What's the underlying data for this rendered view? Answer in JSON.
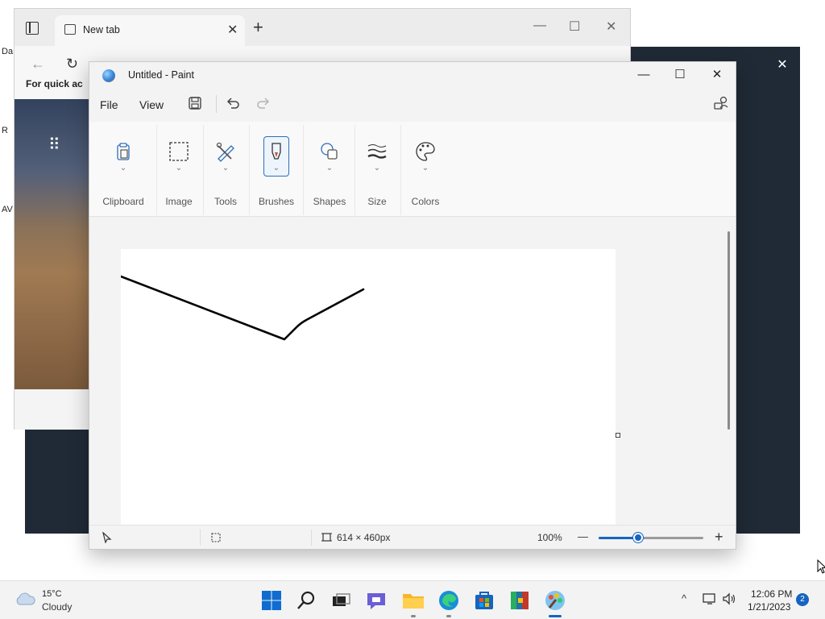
{
  "desktop": {
    "labels": [
      "Da",
      "R",
      "AV"
    ]
  },
  "browser": {
    "tab_title": "New tab",
    "tab_close": "✕",
    "new_tab": "+",
    "minimize": "—",
    "maximize": "☐",
    "close": "✕",
    "quick_access_text": "For quick ac",
    "back_icon": "←",
    "refresh_icon": "↻"
  },
  "dark_panel": {
    "close": "✕"
  },
  "paint": {
    "title": "Untitled - Paint",
    "window_buttons": {
      "minimize": "—",
      "maximize": "☐",
      "close": "✕"
    },
    "menu": {
      "file": "File",
      "view": "View"
    },
    "ribbon_groups": [
      {
        "label": "Clipboard",
        "icon": "clipboard-icon"
      },
      {
        "label": "Image",
        "icon": "selection-icon"
      },
      {
        "label": "Tools",
        "icon": "tools-icon"
      },
      {
        "label": "Brushes",
        "icon": "brush-icon"
      },
      {
        "label": "Shapes",
        "icon": "shapes-icon"
      },
      {
        "label": "Size",
        "icon": "size-icon"
      },
      {
        "label": "Colors",
        "icon": "palette-icon"
      }
    ],
    "chevron": "⌄",
    "status": {
      "canvas_size": "614 × 460px",
      "zoom": "100%",
      "zoom_out": "—",
      "zoom_in": "+",
      "zoom_level": 0.38
    },
    "stroke_color": "#000000"
  },
  "taskbar": {
    "weather_temp": "15°C",
    "weather_condition": "Cloudy",
    "apps": [
      "start",
      "search",
      "task-view",
      "chat",
      "file-explorer",
      "edge",
      "store",
      "winrar",
      "paint"
    ],
    "time": "12:06 PM",
    "date": "1/21/2023",
    "notification_count": "2",
    "accent": "#1664c0"
  }
}
